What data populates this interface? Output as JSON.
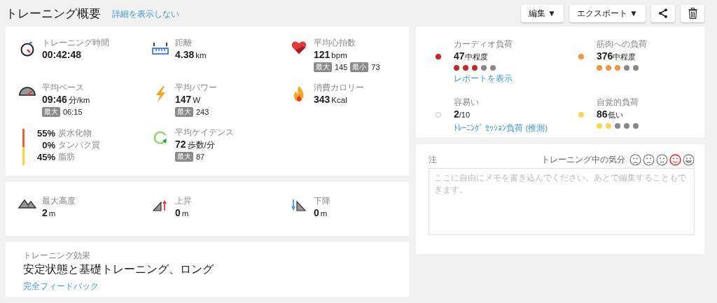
{
  "header": {
    "title": "トレーニング概要",
    "toggle_link": "詳細を表示しない",
    "buttons": [
      {
        "kind": "menu",
        "label": "編集",
        "caret": "▼"
      },
      {
        "kind": "menu",
        "label": "エクスポート",
        "caret": "▼"
      },
      {
        "kind": "share"
      },
      {
        "kind": "delete"
      }
    ]
  },
  "stats": [
    {
      "kind": "stat",
      "label": "トレーニング時間",
      "value": "00:42:48"
    },
    {
      "kind": "stat",
      "label": "距離",
      "value": "4.38",
      "unit": "km"
    },
    {
      "kind": "stat",
      "label": "平均心拍数",
      "value": "121",
      "unit": "bpm",
      "subs": [
        {
          "tag": "最大",
          "value": "145"
        },
        {
          "tag": "最小",
          "value": "73"
        }
      ]
    },
    {
      "kind": "stat",
      "label": "平均ペース",
      "value": "09:46",
      "unit": "分/km",
      "subs": [
        {
          "tag": "最大",
          "value": "06:15"
        }
      ]
    },
    {
      "kind": "stat",
      "label": "平均パワー",
      "value": "147",
      "unit": "W",
      "subs": [
        {
          "tag": "最大",
          "value": "243"
        }
      ]
    },
    {
      "kind": "stat",
      "label": "消費カロリー",
      "value": "343",
      "unit": "Kcal"
    },
    {
      "kind": "macros",
      "items": [
        {
          "percent": "55%",
          "label": "炭水化物",
          "color": "#f0602a"
        },
        {
          "percent": "0%",
          "label": "タンパク質"
        },
        {
          "percent": "45%",
          "label": "脂肪",
          "color": "#f7d33c"
        }
      ]
    },
    {
      "kind": "stat",
      "label": "平均ケイデンス",
      "value": "72",
      "unit": "歩数/分",
      "subs": [
        {
          "tag": "最大",
          "value": "87"
        }
      ]
    }
  ],
  "elevation": [
    {
      "label": "最大高度",
      "value": "2",
      "unit": "m"
    },
    {
      "label": "上昇",
      "value": "0",
      "unit": "m"
    },
    {
      "label": "下降",
      "value": "0",
      "unit": "m"
    }
  ],
  "training_effect": {
    "label": "トレーニング効果",
    "value": "安定状態と基礎トレーニング、ロング",
    "link": "完全フィードバック"
  },
  "loads": [
    {
      "kind": "dot",
      "color": "#c62828",
      "label": "カーディオ負荷",
      "value": "47",
      "suffix": "中程度",
      "stars": 3,
      "link": "レポートを表示"
    },
    {
      "kind": "dot",
      "color": "#f0963c",
      "label": "筋肉への負荷",
      "value": "376",
      "suffix": "中程度",
      "stars": 3
    },
    {
      "kind": "ring",
      "color": "#c8c8c8",
      "label": "容易い",
      "value": "2",
      "suffix": "/10",
      "link": "ﾄﾚｰﾆﾝｸﾞ ｾｯｼｮﾝ負荷 (推測)"
    },
    {
      "kind": "dot",
      "color": "#f7d850",
      "label": "自覚的負荷",
      "value": "86",
      "suffix": "低い",
      "stars": 2
    }
  ],
  "notes": {
    "label": "注",
    "mood_label": "トレーニング中の気分",
    "moods": [
      {
        "selected": false
      },
      {
        "selected": false
      },
      {
        "selected": false
      },
      {
        "selected": true
      },
      {
        "selected": false
      }
    ],
    "placeholder": "ここに自由にメモを書き込んでください。あとで編集することもできます。"
  }
}
